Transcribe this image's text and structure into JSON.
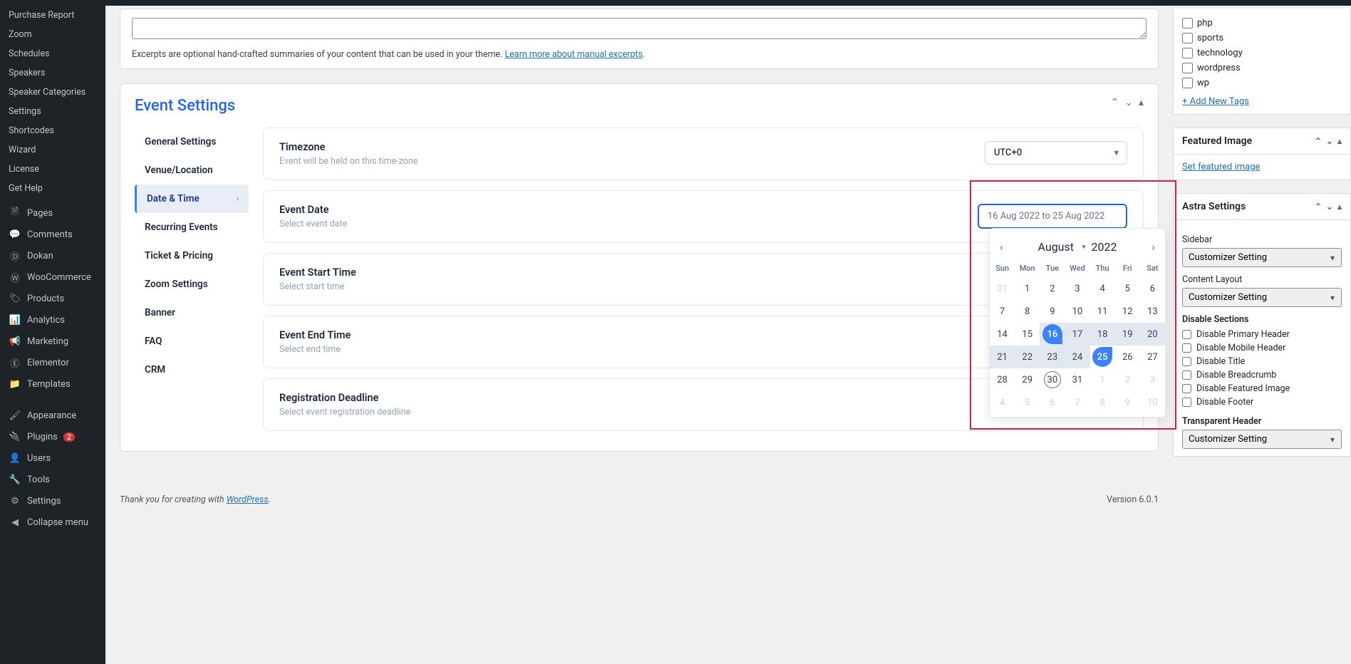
{
  "sidebar": {
    "sub_items": [
      "Purchase Report",
      "Zoom",
      "Schedules",
      "Speakers",
      "Speaker Categories",
      "Settings",
      "Shortcodes",
      "Wizard",
      "License",
      "Get Help"
    ],
    "main_items": [
      {
        "label": "Pages",
        "icon": "page"
      },
      {
        "label": "Comments",
        "icon": "comment"
      },
      {
        "label": "Dokan",
        "icon": "dokan"
      },
      {
        "label": "WooCommerce",
        "icon": "woo"
      },
      {
        "label": "Products",
        "icon": "products"
      },
      {
        "label": "Analytics",
        "icon": "analytics"
      },
      {
        "label": "Marketing",
        "icon": "marketing"
      },
      {
        "label": "Elementor",
        "icon": "elementor"
      },
      {
        "label": "Templates",
        "icon": "templates"
      },
      {
        "label": "Appearance",
        "icon": "appearance"
      },
      {
        "label": "Plugins",
        "icon": "plugins",
        "badge": "2"
      },
      {
        "label": "Users",
        "icon": "users"
      },
      {
        "label": "Tools",
        "icon": "tools"
      },
      {
        "label": "Settings",
        "icon": "settings"
      },
      {
        "label": "Collapse menu",
        "icon": "collapse"
      }
    ]
  },
  "excerpt": {
    "help": "Excerpts are optional hand-crafted summaries of your content that can be used in your theme. ",
    "link": "Learn more about manual excerpts"
  },
  "panel_title": "Event Settings",
  "tabs": [
    "General Settings",
    "Venue/Location",
    "Date & Time",
    "Recurring Events",
    "Ticket & Pricing",
    "Zoom Settings",
    "Banner",
    "FAQ",
    "CRM"
  ],
  "fields": {
    "timezone": {
      "label": "Timezone",
      "desc": "Event will be held on this time-zone",
      "value": "UTC+0"
    },
    "event_date": {
      "label": "Event Date",
      "desc": "Select event date",
      "value": "16 Aug 2022 to 25 Aug 2022"
    },
    "start_time": {
      "label": "Event Start Time",
      "desc": "Select start time"
    },
    "end_time": {
      "label": "Event End Time",
      "desc": "Select end time"
    },
    "deadline": {
      "label": "Registration Deadline",
      "desc": "Select event registration deadline"
    }
  },
  "calendar": {
    "month": "August",
    "year": "2022",
    "daynames": [
      "Sun",
      "Mon",
      "Tue",
      "Wed",
      "Thu",
      "Fri",
      "Sat"
    ],
    "cells": [
      {
        "d": "31",
        "cls": "out"
      },
      {
        "d": "1"
      },
      {
        "d": "2"
      },
      {
        "d": "3"
      },
      {
        "d": "4"
      },
      {
        "d": "5"
      },
      {
        "d": "6"
      },
      {
        "d": "7"
      },
      {
        "d": "8"
      },
      {
        "d": "9"
      },
      {
        "d": "10"
      },
      {
        "d": "11"
      },
      {
        "d": "12"
      },
      {
        "d": "13"
      },
      {
        "d": "14"
      },
      {
        "d": "15"
      },
      {
        "d": "16",
        "cls": "rng-start"
      },
      {
        "d": "17",
        "cls": "inrange"
      },
      {
        "d": "18",
        "cls": "inrange"
      },
      {
        "d": "19",
        "cls": "inrange"
      },
      {
        "d": "20",
        "cls": "inrange"
      },
      {
        "d": "21",
        "cls": "inrange"
      },
      {
        "d": "22",
        "cls": "inrange"
      },
      {
        "d": "23",
        "cls": "inrange"
      },
      {
        "d": "24",
        "cls": "inrange"
      },
      {
        "d": "25",
        "cls": "rng-end"
      },
      {
        "d": "26"
      },
      {
        "d": "27"
      },
      {
        "d": "28"
      },
      {
        "d": "29"
      },
      {
        "d": "30",
        "cls": "today"
      },
      {
        "d": "31"
      },
      {
        "d": "1",
        "cls": "out"
      },
      {
        "d": "2",
        "cls": "out"
      },
      {
        "d": "3",
        "cls": "out"
      },
      {
        "d": "4",
        "cls": "out"
      },
      {
        "d": "5",
        "cls": "out"
      },
      {
        "d": "6",
        "cls": "out"
      },
      {
        "d": "7",
        "cls": "out"
      },
      {
        "d": "8",
        "cls": "out"
      },
      {
        "d": "9",
        "cls": "out"
      },
      {
        "d": "10",
        "cls": "out"
      }
    ]
  },
  "tags": [
    "php",
    "sports",
    "technology",
    "wordpress",
    "wp"
  ],
  "add_tags": "+ Add New Tags",
  "featured": {
    "title": "Featured Image",
    "link": "Set featured image"
  },
  "astra": {
    "title": "Astra Settings",
    "sidebar_lbl": "Sidebar",
    "sidebar_val": "Customizer Setting",
    "layout_lbl": "Content Layout",
    "layout_val": "Customizer Setting",
    "disable_lbl": "Disable Sections",
    "disables": [
      "Disable Primary Header",
      "Disable Mobile Header",
      "Disable Title",
      "Disable Breadcrumb",
      "Disable Featured Image",
      "Disable Footer"
    ],
    "transp_lbl": "Transparent Header",
    "transp_val": "Customizer Setting"
  },
  "footer": {
    "thanks": "Thank you for creating with ",
    "wp_link": "WordPress",
    "version": "Version 6.0.1"
  }
}
